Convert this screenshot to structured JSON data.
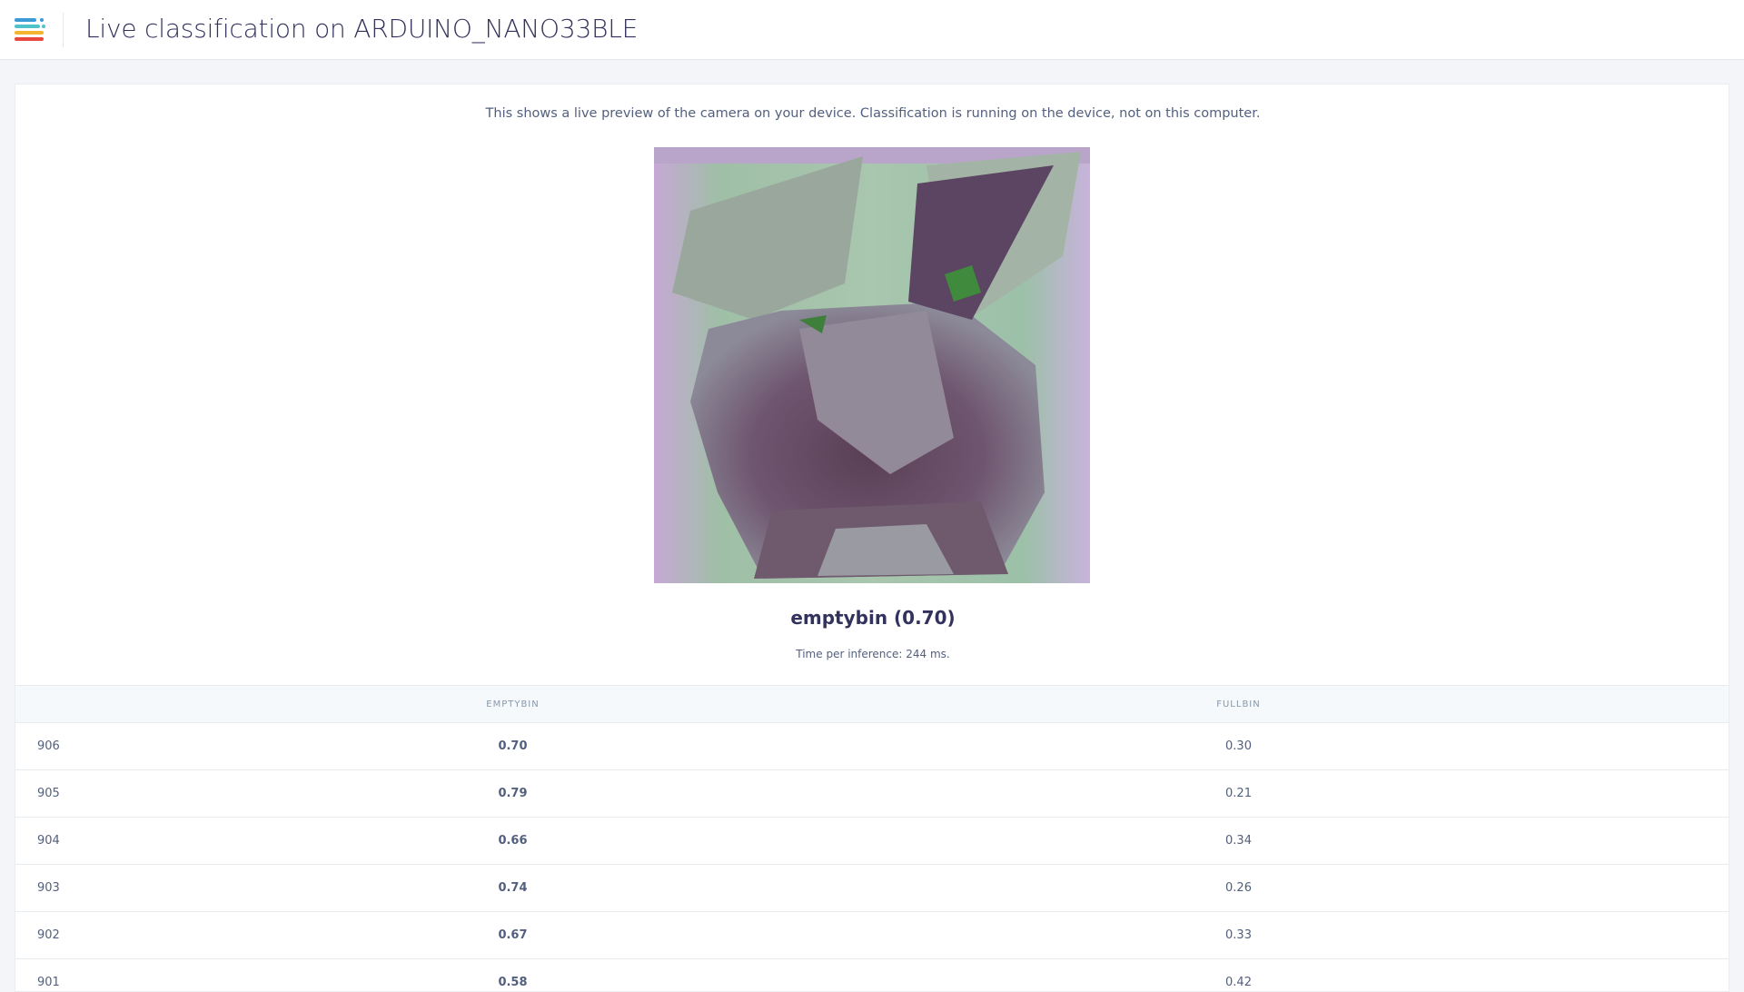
{
  "header": {
    "title": "Live classification on ARDUINO_NANO33BLE",
    "logo_icon": "edge-impulse-logo-icon",
    "logo_colors": [
      "#3b9bd6",
      "#4fc3c9",
      "#f5b52e",
      "#e8493c"
    ]
  },
  "preview": {
    "description": "This shows a live preview of the camera on your device. Classification is running on the device, not on this computer.",
    "classification": "emptybin (0.70)",
    "inference_time": "Time per inference: 244 ms."
  },
  "results_table": {
    "columns": [
      "",
      "EMPTYBIN",
      "FULLBIN"
    ],
    "rows": [
      {
        "id": "906",
        "emptybin": "0.70",
        "fullbin": "0.30",
        "top": "emptybin"
      },
      {
        "id": "905",
        "emptybin": "0.79",
        "fullbin": "0.21",
        "top": "emptybin"
      },
      {
        "id": "904",
        "emptybin": "0.66",
        "fullbin": "0.34",
        "top": "emptybin"
      },
      {
        "id": "903",
        "emptybin": "0.74",
        "fullbin": "0.26",
        "top": "emptybin"
      },
      {
        "id": "902",
        "emptybin": "0.67",
        "fullbin": "0.33",
        "top": "emptybin"
      },
      {
        "id": "901",
        "emptybin": "0.58",
        "fullbin": "0.42",
        "top": "emptybin"
      }
    ]
  }
}
